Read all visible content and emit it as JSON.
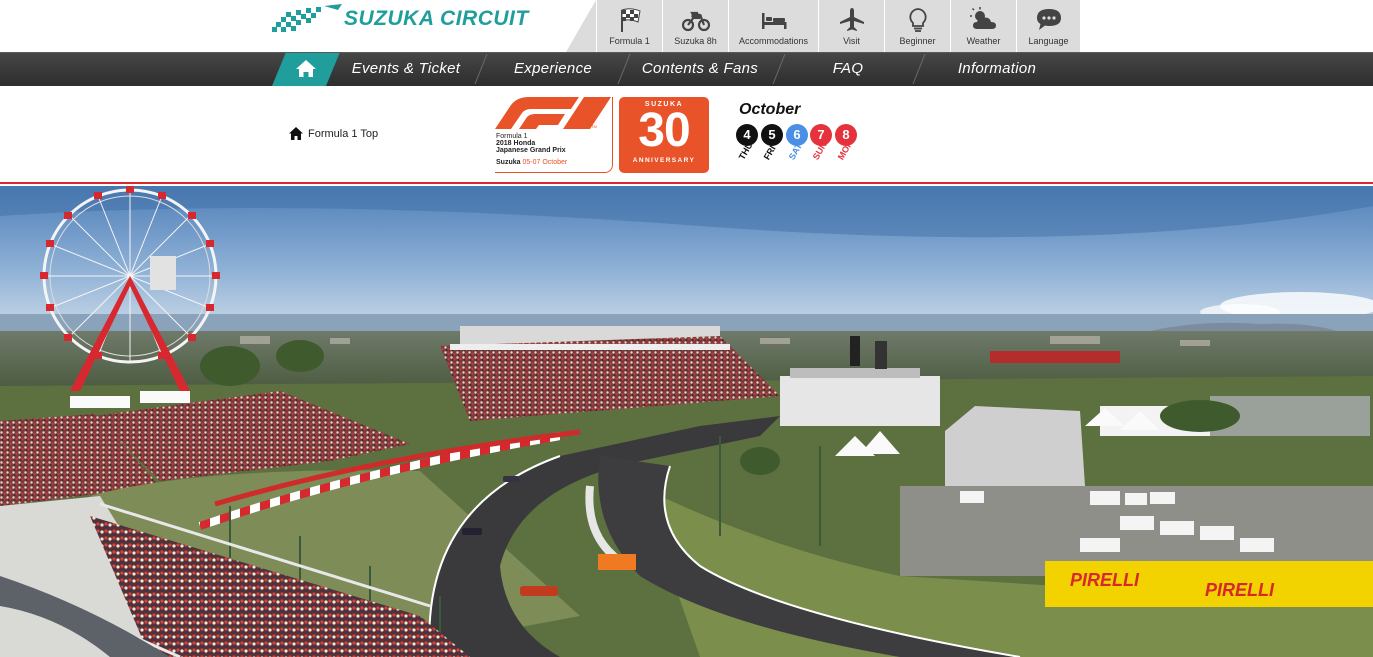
{
  "brand": {
    "logo_text": "SUZUKA CIRCUIT",
    "accent_color": "#1f9e9b"
  },
  "icon_nav": [
    {
      "label": "Formula 1",
      "icon": "checkered-flag-icon"
    },
    {
      "label": "Suzuka 8h",
      "icon": "motorcycle-icon"
    },
    {
      "label": "Accommodations",
      "icon": "bed-icon"
    },
    {
      "label": "Visit",
      "icon": "airplane-icon"
    },
    {
      "label": "Beginner",
      "icon": "lightbulb-icon"
    },
    {
      "label": "Weather",
      "icon": "weather-icon"
    },
    {
      "label": "Language",
      "icon": "speech-bubble-icon"
    }
  ],
  "main_nav": {
    "home_icon": "home-icon",
    "items": [
      "Events & Ticket",
      "Experience",
      "Contents & Fans",
      "FAQ",
      "Information"
    ]
  },
  "breadcrumb": {
    "label": "Formula 1 Top",
    "icon": "home-icon"
  },
  "event_logo": {
    "line1": "Formula 1",
    "line2": "2018 Honda",
    "line3": "Japanese Grand Prix",
    "venue": "Suzuka",
    "dates": "05-07 October",
    "brand_color": "#e8532a"
  },
  "anniversary": {
    "top": "SUZUKA",
    "number": "30",
    "bottom": "ANNIVERSARY"
  },
  "calendar": {
    "month": "October",
    "days": [
      {
        "num": "4",
        "dow": "THU",
        "color": "#111111"
      },
      {
        "num": "5",
        "dow": "FRI",
        "color": "#111111"
      },
      {
        "num": "6",
        "dow": "SAT",
        "color": "#4a8fe6"
      },
      {
        "num": "7",
        "dow": "SUN",
        "color": "#e6323c"
      },
      {
        "num": "8",
        "dow": "MON",
        "color": "#e6323c"
      }
    ]
  },
  "hero": {
    "banner_text": "PIRELLI"
  }
}
